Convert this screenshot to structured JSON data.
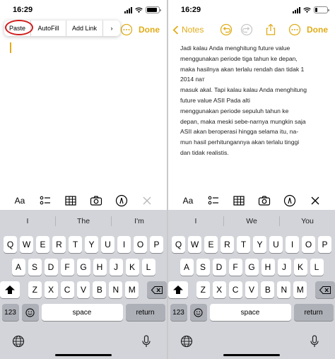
{
  "status": {
    "time": "16:29",
    "battery_right": "20"
  },
  "left": {
    "nav": {
      "done": "Done"
    },
    "edit_menu": {
      "items": [
        "Paste",
        "AutoFill",
        "Add Link",
        "›"
      ]
    },
    "suggestions": [
      "I",
      "The",
      "I'm"
    ]
  },
  "right": {
    "nav": {
      "back": "Notes",
      "done": "Done"
    },
    "note": "Jadi kalau Anda menghitung future value\nmenggunakan periode tiga tahun ke depan,\nmaka hasilnya akan terlalu rendah dan tidak 1\n2014 пат\nmasuk akal. Tapi kalau kalau Anda menghitung\nfuture value ASII Pada alti\nmenggunakan periode sepuluh tahun ke\ndepan, maka meski sebe-narnya mungkin saja\nASII akan beroperasi hingga selama itu, na-\nmun hasil perhitungannya akan terlalu tinggi\ndan tidak realistis.",
    "suggestions": [
      "I",
      "We",
      "You"
    ]
  },
  "toolbar": {
    "format": "Aa"
  },
  "keyboard": {
    "row1": [
      "Q",
      "W",
      "E",
      "R",
      "T",
      "Y",
      "U",
      "I",
      "O",
      "P"
    ],
    "row2": [
      "A",
      "S",
      "D",
      "F",
      "G",
      "H",
      "J",
      "K",
      "L"
    ],
    "row3": [
      "Z",
      "X",
      "C",
      "V",
      "B",
      "N",
      "M"
    ],
    "num": "123",
    "space": "space",
    "return": "return"
  },
  "colors": {
    "accent": "#e0ac18",
    "highlight": "#d01c1c"
  }
}
